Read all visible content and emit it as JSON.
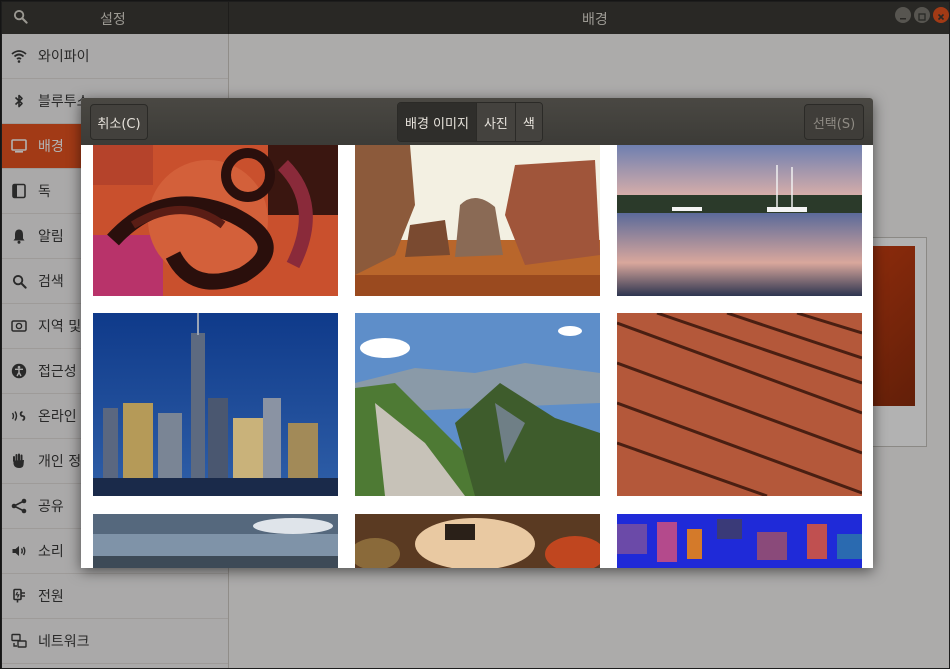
{
  "app": {
    "sidebar_title": "설정",
    "panel_title": "배경"
  },
  "sidebar": {
    "items": [
      {
        "label": "와이파이",
        "icon": "wifi-icon"
      },
      {
        "label": "블루투스",
        "icon": "bluetooth-icon"
      },
      {
        "label": "배경",
        "icon": "background-icon",
        "active": true
      },
      {
        "label": "독",
        "icon": "dock-icon"
      },
      {
        "label": "알림",
        "icon": "bell-icon"
      },
      {
        "label": "검색",
        "icon": "search-icon"
      },
      {
        "label": "지역 및",
        "icon": "region-icon"
      },
      {
        "label": "접근성",
        "icon": "accessibility-icon"
      },
      {
        "label": "온라인 ",
        "icon": "online-accounts-icon"
      },
      {
        "label": "개인 정",
        "icon": "privacy-hand-icon"
      },
      {
        "label": "공유",
        "icon": "share-icon"
      },
      {
        "label": "소리",
        "icon": "speaker-icon"
      },
      {
        "label": "전원",
        "icon": "power-plug-icon"
      },
      {
        "label": "네트워크",
        "icon": "network-icon"
      }
    ]
  },
  "dialog": {
    "cancel_label": "취소(C)",
    "select_label": "선택(S)",
    "tabs": [
      {
        "label": "배경 이미지",
        "active": true
      },
      {
        "label": "사진",
        "active": false
      },
      {
        "label": "색",
        "active": false
      }
    ],
    "thumbnails": [
      "abstract-swirl",
      "rock-formations",
      "harbor-sunset",
      "city-skyline",
      "mountain-ridge",
      "wood-deck",
      "coastal-sky",
      "market-baskets",
      "pixel-art"
    ]
  },
  "colors": {
    "accent": "#e95420",
    "headerbar": "#3b3a36"
  }
}
